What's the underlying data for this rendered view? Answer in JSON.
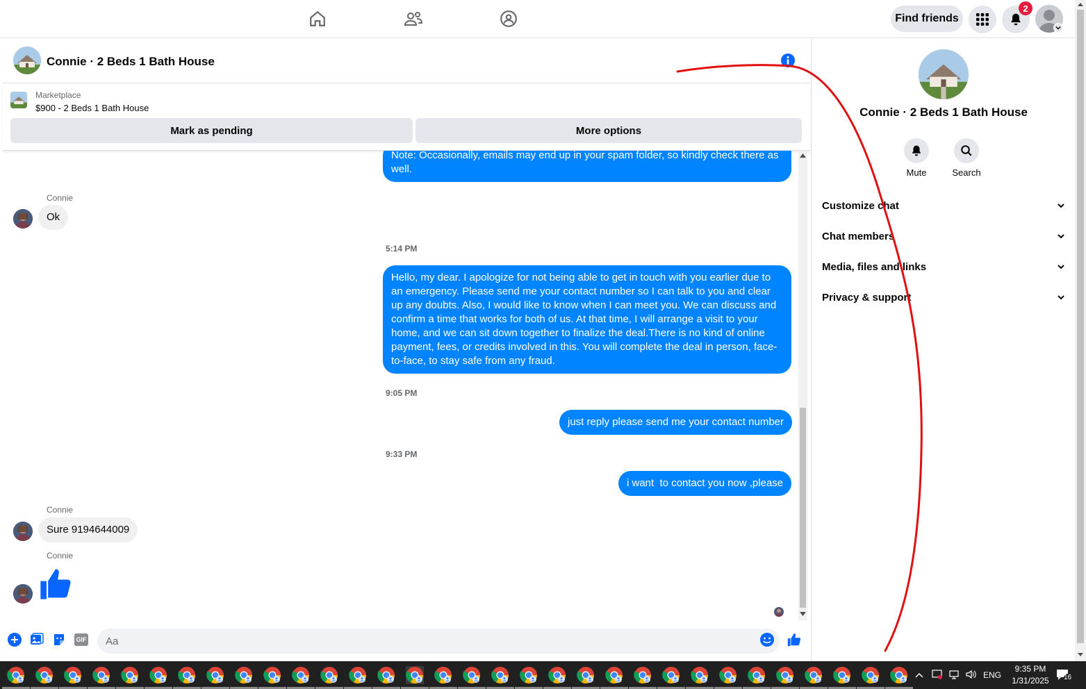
{
  "topbar": {
    "find_friends": "Find friends",
    "notification_count": "2"
  },
  "chat": {
    "title": "Connie · 2 Beds 1 Bath House"
  },
  "marketplace": {
    "label": "Marketplace",
    "listing": "$900 - 2 Beds 1 Bath House",
    "mark_pending": "Mark as pending",
    "more_options": "More options"
  },
  "messages": {
    "m1": "Note: Occasionally, emails may end up in your spam folder, so kindly check there as well.",
    "sender1": "Connie",
    "m2": "Ok",
    "time1": "5:14 PM",
    "m3": "Hello, my dear. I apologize for not being able to get in touch with you earlier due to an emergency. Please send me your contact number so I can talk to you and clear up any doubts. Also, I would like to know when I can meet you. We can discuss and confirm a time that works for both of us. At that time, I will arrange a visit to your home, and we can sit down together to finalize the deal.There is no kind of online payment, fees, or credits involved in this. You will complete the deal in person, face-to-face, to stay safe from any fraud.",
    "time2": "9:05 PM",
    "m4": "just reply please send me your contact number",
    "time3": "9:33 PM",
    "m5": "i want  to contact you now ,please",
    "sender2": "Connie",
    "m6": "Sure 9194644009",
    "sender3": "Connie"
  },
  "composer": {
    "placeholder": "Aa",
    "gif": "GIF"
  },
  "panel": {
    "title": "Connie · 2 Beds 1 Bath House",
    "mute": "Mute",
    "search": "Search",
    "items": [
      "Customize chat",
      "Chat members",
      "Media, files and links",
      "Privacy & support"
    ]
  },
  "taskbar": {
    "lang": "ENG",
    "time": "9:35 PM",
    "date": "1/31/2025",
    "notif_count": "16"
  },
  "colors": {
    "messenger_blue": "#0084ff",
    "annotation_red": "#e01010"
  }
}
